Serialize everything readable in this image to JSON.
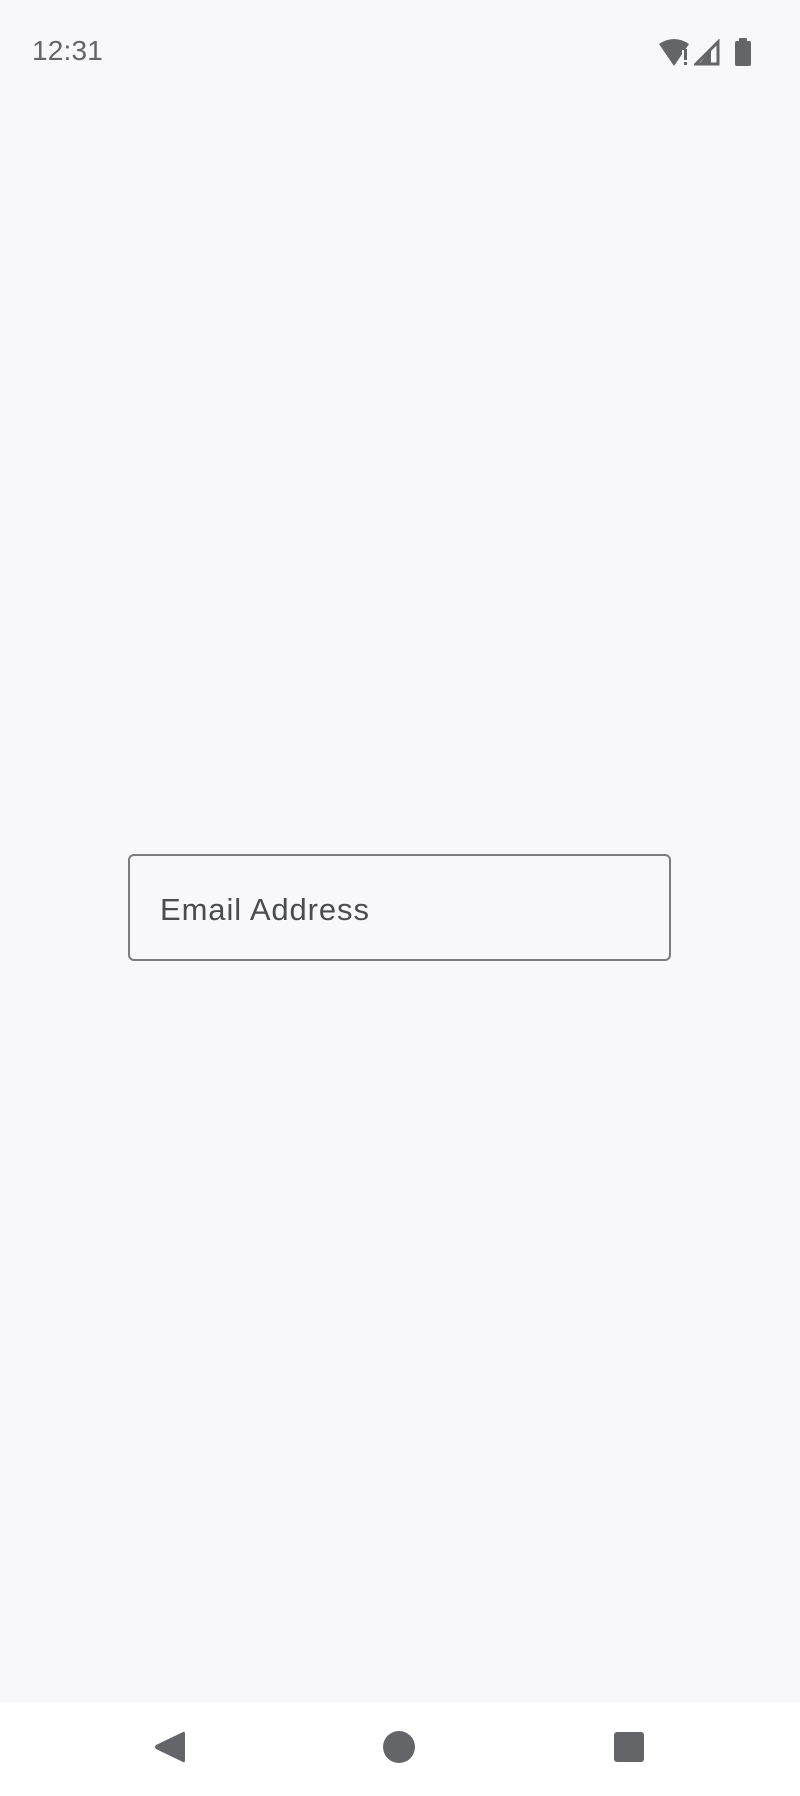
{
  "status_bar": {
    "time": "12:31",
    "icons": [
      "wifi-alert-icon",
      "cellular-signal-icon",
      "battery-icon"
    ]
  },
  "form": {
    "email_placeholder": "Email Address",
    "email_value": ""
  },
  "navigation": {
    "buttons": [
      "back-icon",
      "home-icon",
      "recents-icon"
    ]
  },
  "colors": {
    "background": "#f8f8fa",
    "icon_gray": "#646569",
    "field_border": "#7c7c80",
    "placeholder_text": "#4b4c50",
    "navigation_background": "#ffffff"
  }
}
